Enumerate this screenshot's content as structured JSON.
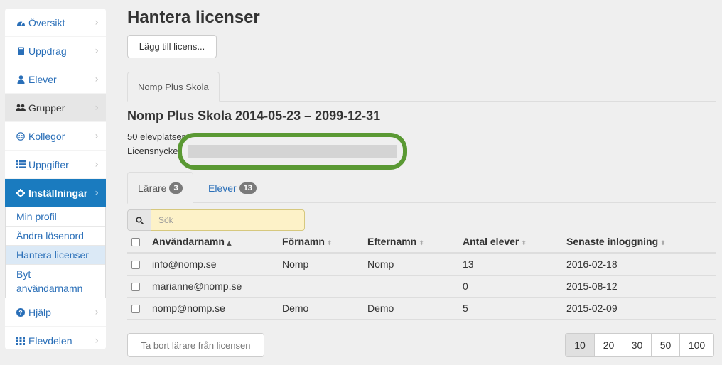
{
  "sidebar": {
    "items": [
      {
        "label": "Översikt",
        "icon": "dashboard-icon"
      },
      {
        "label": "Uppdrag",
        "icon": "book-icon"
      },
      {
        "label": "Elever",
        "icon": "user-icon"
      },
      {
        "label": "Grupper",
        "icon": "users-icon"
      },
      {
        "label": "Kollegor",
        "icon": "smile-icon"
      },
      {
        "label": "Uppgifter",
        "icon": "list-icon"
      },
      {
        "label": "Inställningar",
        "icon": "gear-icon"
      },
      {
        "label": "Hjälp",
        "icon": "question-icon"
      },
      {
        "label": "Elevdelen",
        "icon": "grid-icon"
      }
    ],
    "subitems": [
      {
        "label": "Min profil"
      },
      {
        "label": "Ändra lösenord"
      },
      {
        "label": "Hantera licenser"
      },
      {
        "label": "Byt användarnamn"
      }
    ],
    "chevron": "›"
  },
  "main": {
    "title": "Hantera licenser",
    "add_button": "Lägg till licens...",
    "license_tab": "Nomp Plus Skola",
    "license_title": "Nomp Plus Skola 2014-05-23 – 2099-12-31",
    "seats_text": "50 elevplatser",
    "key_label": "Licensnyckel:",
    "user_tabs": [
      {
        "label": "Lärare",
        "count": "3"
      },
      {
        "label": "Elever",
        "count": "13"
      }
    ],
    "search_placeholder": "Sök",
    "columns": [
      "Användarnamn",
      "Förnamn",
      "Efternamn",
      "Antal elever",
      "Senaste inloggning"
    ],
    "sort_asc": "▲",
    "sort_both": "⬍",
    "rows": [
      [
        "info@nomp.se",
        "Nomp",
        "Nomp",
        "13",
        "2016-02-18"
      ],
      [
        "marianne@nomp.se",
        "",
        "",
        "0",
        "2015-08-12"
      ],
      [
        "nomp@nomp.se",
        "Demo",
        "Demo",
        "5",
        "2015-02-09"
      ]
    ],
    "remove_button": "Ta bort lärare från licensen",
    "page_sizes": [
      "10",
      "20",
      "30",
      "50",
      "100"
    ]
  },
  "colors": {
    "accent": "#1a7bbf",
    "link": "#2a6fb8",
    "highlight": "#5a9933",
    "search_bg": "#fdf2c8"
  }
}
